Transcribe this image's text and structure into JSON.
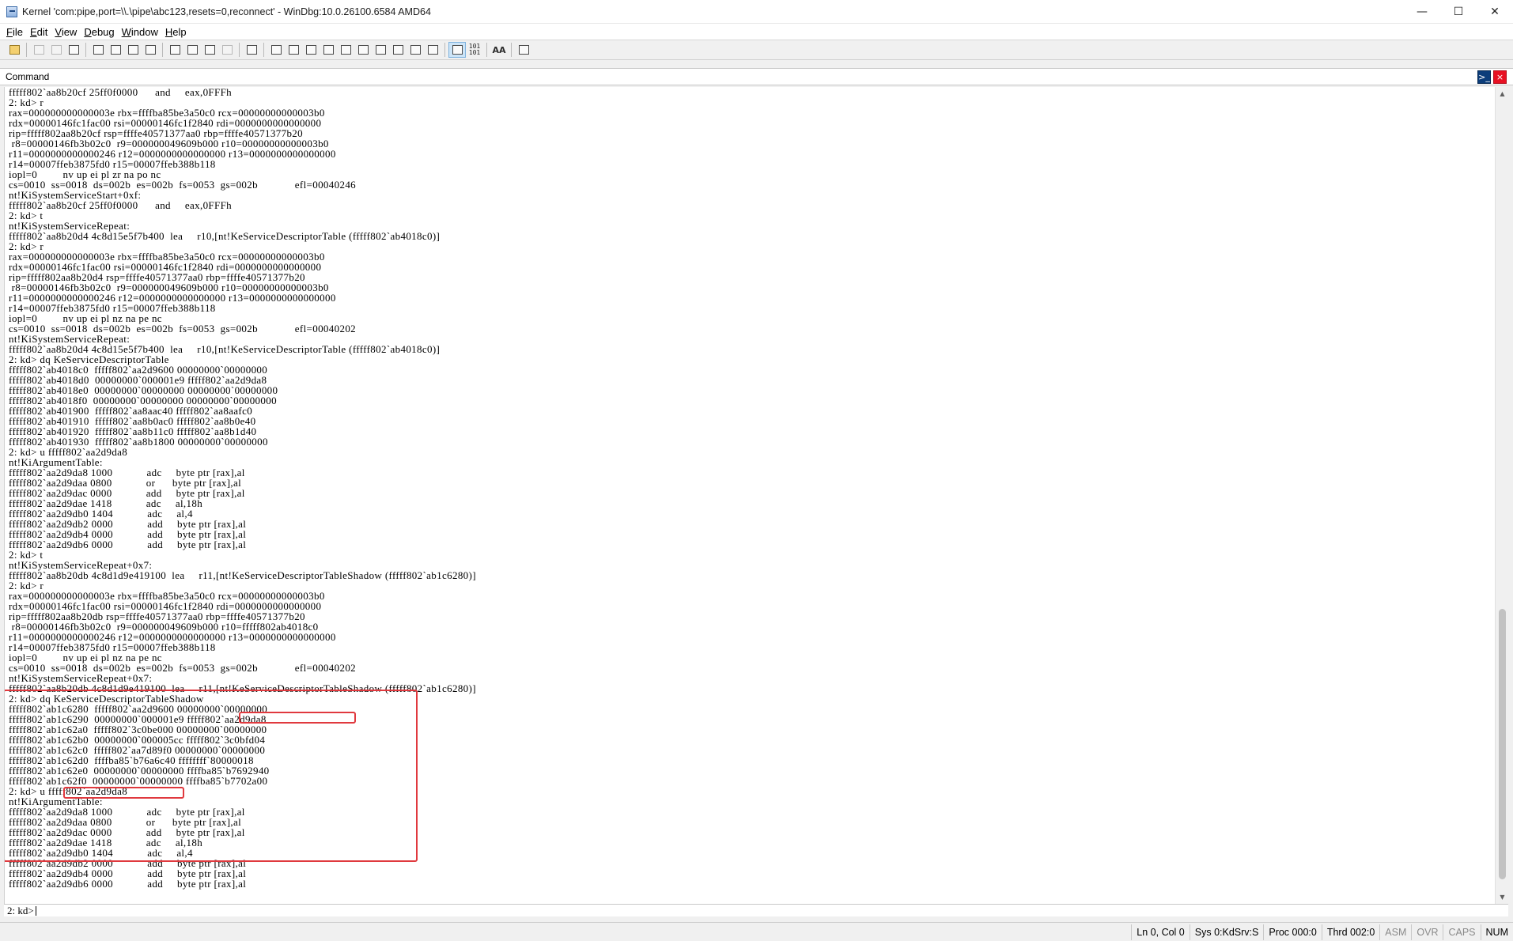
{
  "window": {
    "title": "Kernel 'com:pipe,port=\\\\.\\pipe\\abc123,resets=0,reconnect' - WinDbg:10.0.26100.6584 AMD64",
    "minimize": "—",
    "maximize": "☐",
    "close": "✕"
  },
  "menu": [
    {
      "label": "File",
      "key": "F",
      "rest": "ile"
    },
    {
      "label": "Edit",
      "key": "E",
      "rest": "dit"
    },
    {
      "label": "View",
      "key": "V",
      "rest": "iew"
    },
    {
      "label": "Debug",
      "key": "D",
      "rest": "ebug"
    },
    {
      "label": "Window",
      "key": "W",
      "rest": "indow"
    },
    {
      "label": "Help",
      "key": "H",
      "rest": "elp"
    }
  ],
  "toolbar": {
    "source_mode_label": "101\n101",
    "font_label": "AA"
  },
  "pane": {
    "title": "Command",
    "dock_glyph": ">_",
    "close_glyph": "×"
  },
  "output_lines": [
    "fffff802`aa8b20cf 25ff0f0000      and     eax,0FFFh",
    "2: kd> r",
    "rax=000000000000003e rbx=ffffba85be3a50c0 rcx=00000000000003b0",
    "rdx=00000146fc1fac00 rsi=00000146fc1f2840 rdi=0000000000000000",
    "rip=fffff802aa8b20cf rsp=ffffe40571377aa0 rbp=ffffe40571377b20",
    " r8=00000146fb3b02c0  r9=000000049609b000 r10=00000000000003b0",
    "r11=0000000000000246 r12=0000000000000000 r13=0000000000000000",
    "r14=00007ffeb3875fd0 r15=00007ffeb388b118",
    "iopl=0         nv up ei pl zr na po nc",
    "cs=0010  ss=0018  ds=002b  es=002b  fs=0053  gs=002b             efl=00040246",
    "nt!KiSystemServiceStart+0xf:",
    "fffff802`aa8b20cf 25ff0f0000      and     eax,0FFFh",
    "2: kd> t",
    "nt!KiSystemServiceRepeat:",
    "fffff802`aa8b20d4 4c8d15e5f7b400  lea     r10,[nt!KeServiceDescriptorTable (fffff802`ab4018c0)]",
    "2: kd> r",
    "rax=000000000000003e rbx=ffffba85be3a50c0 rcx=00000000000003b0",
    "rdx=00000146fc1fac00 rsi=00000146fc1f2840 rdi=0000000000000000",
    "rip=fffff802aa8b20d4 rsp=ffffe40571377aa0 rbp=ffffe40571377b20",
    " r8=00000146fb3b02c0  r9=000000049609b000 r10=00000000000003b0",
    "r11=0000000000000246 r12=0000000000000000 r13=0000000000000000",
    "r14=00007ffeb3875fd0 r15=00007ffeb388b118",
    "iopl=0         nv up ei pl nz na pe nc",
    "cs=0010  ss=0018  ds=002b  es=002b  fs=0053  gs=002b             efl=00040202",
    "nt!KiSystemServiceRepeat:",
    "fffff802`aa8b20d4 4c8d15e5f7b400  lea     r10,[nt!KeServiceDescriptorTable (fffff802`ab4018c0)]",
    "2: kd> dq KeServiceDescriptorTable",
    "fffff802`ab4018c0  fffff802`aa2d9600 00000000`00000000",
    "fffff802`ab4018d0  00000000`000001e9 fffff802`aa2d9da8",
    "fffff802`ab4018e0  00000000`00000000 00000000`00000000",
    "fffff802`ab4018f0  00000000`00000000 00000000`00000000",
    "fffff802`ab401900  fffff802`aa8aac40 fffff802`aa8aafc0",
    "fffff802`ab401910  fffff802`aa8b0ac0 fffff802`aa8b0e40",
    "fffff802`ab401920  fffff802`aa8b11c0 fffff802`aa8b1d40",
    "fffff802`ab401930  fffff802`aa8b1800 00000000`00000000",
    "2: kd> u fffff802`aa2d9da8",
    "nt!KiArgumentTable:",
    "fffff802`aa2d9da8 1000            adc     byte ptr [rax],al",
    "fffff802`aa2d9daa 0800            or      byte ptr [rax],al",
    "fffff802`aa2d9dac 0000            add     byte ptr [rax],al",
    "fffff802`aa2d9dae 1418            adc     al,18h",
    "fffff802`aa2d9db0 1404            adc     al,4",
    "fffff802`aa2d9db2 0000            add     byte ptr [rax],al",
    "fffff802`aa2d9db4 0000            add     byte ptr [rax],al",
    "fffff802`aa2d9db6 0000            add     byte ptr [rax],al",
    "2: kd> t",
    "nt!KiSystemServiceRepeat+0x7:",
    "fffff802`aa8b20db 4c8d1d9e419100  lea     r11,[nt!KeServiceDescriptorTableShadow (fffff802`ab1c6280)]",
    "2: kd> r",
    "rax=000000000000003e rbx=ffffba85be3a50c0 rcx=00000000000003b0",
    "rdx=00000146fc1fac00 rsi=00000146fc1f2840 rdi=0000000000000000",
    "rip=fffff802aa8b20db rsp=ffffe40571377aa0 rbp=ffffe40571377b20",
    " r8=00000146fb3b02c0  r9=000000049609b000 r10=fffff802ab4018c0",
    "r11=0000000000000246 r12=0000000000000000 r13=0000000000000000",
    "r14=00007ffeb3875fd0 r15=00007ffeb388b118",
    "iopl=0         nv up ei pl nz na pe nc",
    "cs=0010  ss=0018  ds=002b  es=002b  fs=0053  gs=002b             efl=00040202",
    "nt!KiSystemServiceRepeat+0x7:",
    "fffff802`aa8b20db 4c8d1d9e419100  lea     r11,[nt!KeServiceDescriptorTableShadow (fffff802`ab1c6280)]",
    "2: kd> dq KeServiceDescriptorTableShadow",
    "fffff802`ab1c6280  fffff802`aa2d9600 00000000`00000000",
    "fffff802`ab1c6290  00000000`000001e9 fffff802`aa2d9da8",
    "fffff802`ab1c62a0  fffff802`3c0be000 00000000`00000000",
    "fffff802`ab1c62b0  00000000`000005cc fffff802`3c0bfd04",
    "fffff802`ab1c62c0  fffff802`aa7d89f0 00000000`00000000",
    "fffff802`ab1c62d0  ffffba85`b76a6c40 ffffffff`80000018",
    "fffff802`ab1c62e0  00000000`00000000 ffffba85`b7692940",
    "fffff802`ab1c62f0  00000000`00000000 ffffba85`b7702a00",
    "2: kd> u fffff802`aa2d9da8",
    "nt!KiArgumentTable:",
    "fffff802`aa2d9da8 1000            adc     byte ptr [rax],al",
    "fffff802`aa2d9daa 0800            or      byte ptr [rax],al",
    "fffff802`aa2d9dac 0000            add     byte ptr [rax],al",
    "fffff802`aa2d9dae 1418            adc     al,18h",
    "fffff802`aa2d9db0 1404            adc     al,4",
    "fffff802`aa2d9db2 0000            add     byte ptr [rax],al",
    "fffff802`aa2d9db4 0000            add     byte ptr [rax],al",
    "fffff802`aa2d9db6 0000            add     byte ptr [rax],al"
  ],
  "command": {
    "prompt": "2: kd>",
    "value": ""
  },
  "status": {
    "position": "Ln 0, Col 0",
    "sys": "Sys 0:KdSrv:S",
    "proc": "Proc 000:0",
    "thrd": "Thrd 002:0",
    "asm": "ASM",
    "ovr": "OVR",
    "caps": "CAPS",
    "num": "NUM"
  },
  "colors": {
    "highlight": "#e0393e"
  }
}
